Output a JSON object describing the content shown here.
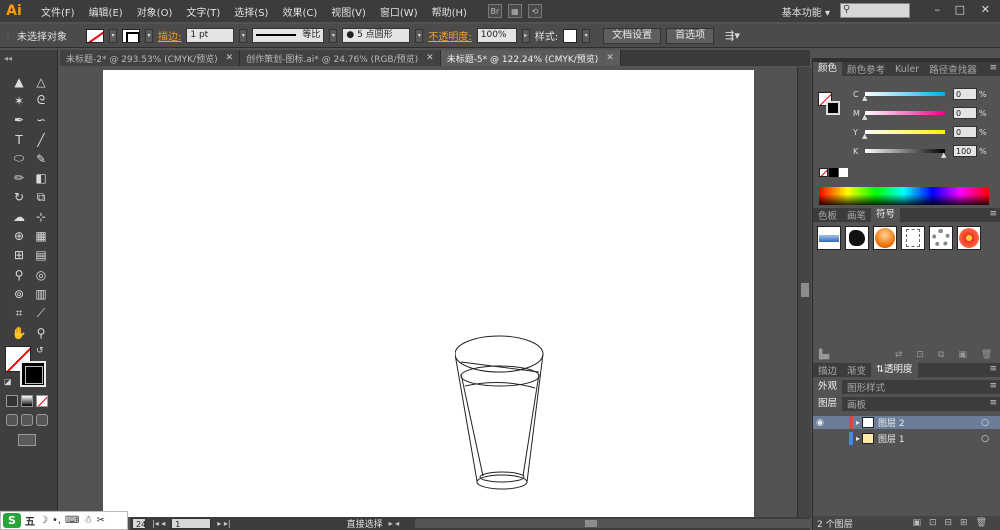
{
  "app": {
    "logo": "Ai"
  },
  "menu": {
    "items": [
      "文件(F)",
      "编辑(E)",
      "对象(O)",
      "文字(T)",
      "选择(S)",
      "效果(C)",
      "视图(V)",
      "窗口(W)",
      "帮助(H)"
    ],
    "bridge_label": "Br",
    "workspace": "基本功能",
    "window_controls": [
      "–",
      "□",
      "✕"
    ]
  },
  "control": {
    "selection": "未选择对象",
    "stroke_label": "描边:",
    "stroke_weight": "1 pt",
    "profile_label": "等比",
    "brush_label": "5 点圆形",
    "opacity_label": "不透明度:",
    "opacity_value": "100%",
    "style_label": "样式:",
    "doc_setup": "文档设置",
    "preferences": "首选项"
  },
  "tabs": [
    {
      "label": "未标题-2* @ 293.53% (CMYK/预览)",
      "active": false
    },
    {
      "label": "创作策划-图标.ai* @ 24.76% (RGB/预览)",
      "active": false
    },
    {
      "label": "未标题-5* @ 122.24% (CMYK/预览)",
      "active": true
    }
  ],
  "tools": [
    {
      "name": "selection-tool-icon",
      "glyph": "▲"
    },
    {
      "name": "direct-selection-tool-icon",
      "glyph": "△"
    },
    {
      "name": "magic-wand-tool-icon",
      "glyph": "✶"
    },
    {
      "name": "lasso-tool-icon",
      "glyph": "ᘓ"
    },
    {
      "name": "pen-tool-icon",
      "glyph": "✒"
    },
    {
      "name": "curvature-tool-icon",
      "glyph": "∽"
    },
    {
      "name": "type-tool-icon",
      "glyph": "T"
    },
    {
      "name": "line-tool-icon",
      "glyph": "╱"
    },
    {
      "name": "ellipse-tool-icon",
      "glyph": "⬭"
    },
    {
      "name": "paintbrush-tool-icon",
      "glyph": "✎"
    },
    {
      "name": "pencil-tool-icon",
      "glyph": "✏"
    },
    {
      "name": "eraser-tool-icon",
      "glyph": "◧"
    },
    {
      "name": "rotate-tool-icon",
      "glyph": "↻"
    },
    {
      "name": "scale-tool-icon",
      "glyph": "⧉"
    },
    {
      "name": "warp-tool-icon",
      "glyph": "☁"
    },
    {
      "name": "free-transform-tool-icon",
      "glyph": "⊹"
    },
    {
      "name": "shape-builder-tool-icon",
      "glyph": "⊕"
    },
    {
      "name": "perspective-grid-tool-icon",
      "glyph": "▦"
    },
    {
      "name": "mesh-tool-icon",
      "glyph": "⊞"
    },
    {
      "name": "gradient-tool-icon",
      "glyph": "▤"
    },
    {
      "name": "eyedropper-tool-icon",
      "glyph": "⚲"
    },
    {
      "name": "blend-tool-icon",
      "glyph": "◎"
    },
    {
      "name": "symbol-sprayer-tool-icon",
      "glyph": "⊚"
    },
    {
      "name": "column-graph-tool-icon",
      "glyph": "▥"
    },
    {
      "name": "artboard-tool-icon",
      "glyph": "⌗"
    },
    {
      "name": "slice-tool-icon",
      "glyph": "⟋"
    },
    {
      "name": "hand-tool-icon",
      "glyph": "✋"
    },
    {
      "name": "zoom-tool-icon",
      "glyph": "⚲"
    }
  ],
  "status": {
    "zoom": "24",
    "artboard": "1",
    "tool_text": "直接选择"
  },
  "ime": {
    "logo": "S",
    "mode": "五",
    "items": [
      "☽",
      "•,",
      "⌨",
      "☃",
      "✂"
    ]
  },
  "color_panel": {
    "tabs": [
      "颜色",
      "颜色参考",
      "Kuler",
      "路径查找器"
    ],
    "channels": [
      {
        "label": "C",
        "value": "0"
      },
      {
        "label": "M",
        "value": "0"
      },
      {
        "label": "Y",
        "value": "0"
      },
      {
        "label": "K",
        "value": "100"
      }
    ],
    "percent": "%"
  },
  "symbols_panel": {
    "tabs": [
      "色板",
      "画笔",
      "符号"
    ],
    "footer_icons": [
      "▙▖",
      "⇄",
      "⊡",
      "⧉",
      "▣",
      "⊞",
      "🗑"
    ]
  },
  "gradient_panel": {
    "tabs": [
      "描边",
      "渐变",
      "透明度"
    ]
  },
  "appearance_panel": {
    "tabs": [
      "外观",
      "图形样式"
    ]
  },
  "layers_panel": {
    "tabs": [
      "图层",
      "画板"
    ],
    "layers": [
      {
        "name": "图层 2",
        "selected": true
      },
      {
        "name": "图层 1",
        "selected": false
      }
    ],
    "count": "2 个图层"
  }
}
